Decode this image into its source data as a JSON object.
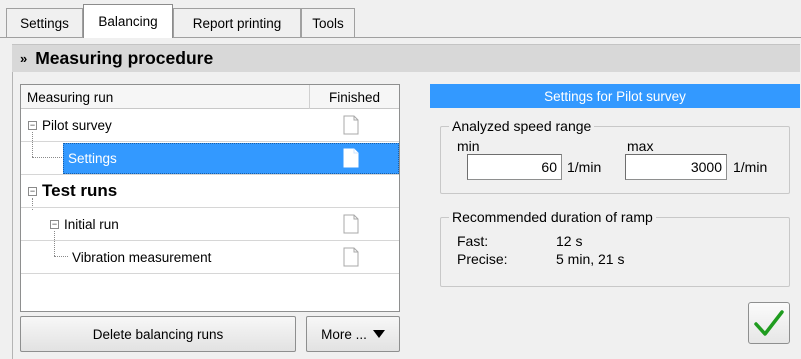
{
  "tabs": [
    {
      "label": "Settings",
      "active": false
    },
    {
      "label": "Balancing",
      "active": true
    },
    {
      "label": "Report printing",
      "active": false
    },
    {
      "label": "Tools",
      "active": false
    }
  ],
  "section": {
    "chevron_icon": "double-chevron-down-icon",
    "title": "Measuring procedure"
  },
  "tree": {
    "columns": {
      "run": "Measuring run",
      "finished": "Finished"
    },
    "rows": [
      {
        "label": "Pilot survey",
        "level": 0,
        "expander": "-",
        "bold": false,
        "selected": false,
        "icon": "document-icon"
      },
      {
        "label": "Settings",
        "level": 1,
        "expander": null,
        "bold": false,
        "selected": true,
        "icon": "document-icon"
      },
      {
        "label": "Test runs",
        "level": 0,
        "expander": "-",
        "bold": true,
        "selected": false,
        "icon": null
      },
      {
        "label": "Initial run",
        "level": 1,
        "expander": "-",
        "bold": false,
        "selected": false,
        "icon": "document-icon"
      },
      {
        "label": "Vibration measurement",
        "level": 2,
        "expander": null,
        "bold": false,
        "selected": false,
        "icon": "document-icon"
      }
    ]
  },
  "buttons": {
    "delete_label": "Delete balancing runs",
    "more_label": "More ...",
    "more_icon": "triangle-down-icon",
    "ok_icon": "checkmark-icon"
  },
  "panel": {
    "title": "Settings for Pilot survey",
    "speed_range": {
      "title": "Analyzed speed range",
      "min_label": "min",
      "min_value": "60",
      "max_label": "max",
      "max_value": "3000",
      "unit": "1/min"
    },
    "ramp": {
      "title": "Recommended duration of ramp",
      "fast_label": "Fast:",
      "fast_value": "12 s",
      "precise_label": "Precise:",
      "precise_value": "5 min, 21 s"
    }
  },
  "colors": {
    "accent": "#3399ff",
    "check": "#1f9c1f",
    "background": "#f0f0f0"
  }
}
